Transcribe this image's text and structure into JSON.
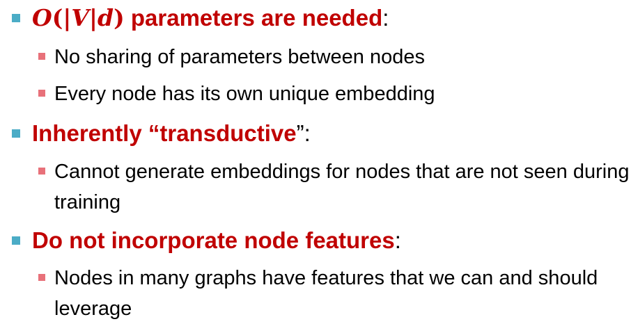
{
  "colors": {
    "level1_bullet": "#4BACC6",
    "level2_bullet": "#E8717A",
    "emphasis": "#C00000",
    "body_text": "#000000"
  },
  "bullets": [
    {
      "math_open": "O",
      "math_paren": "(|",
      "math_V": "V",
      "math_bar": "|",
      "math_d": "d",
      "math_close": ")",
      "emphasis": " parameters are needed",
      "suffix": ":",
      "sub": [
        "No sharing of parameters between nodes",
        "Every node has its own unique embedding"
      ]
    },
    {
      "emphasis": "Inherently “transductive",
      "suffix": "”:",
      "sub": [
        "Cannot generate embeddings for nodes that are not seen during training"
      ]
    },
    {
      "emphasis": "Do not incorporate node features",
      "suffix": ":",
      "sub": [
        "Nodes in many graphs have features that we can and should leverage"
      ]
    }
  ]
}
